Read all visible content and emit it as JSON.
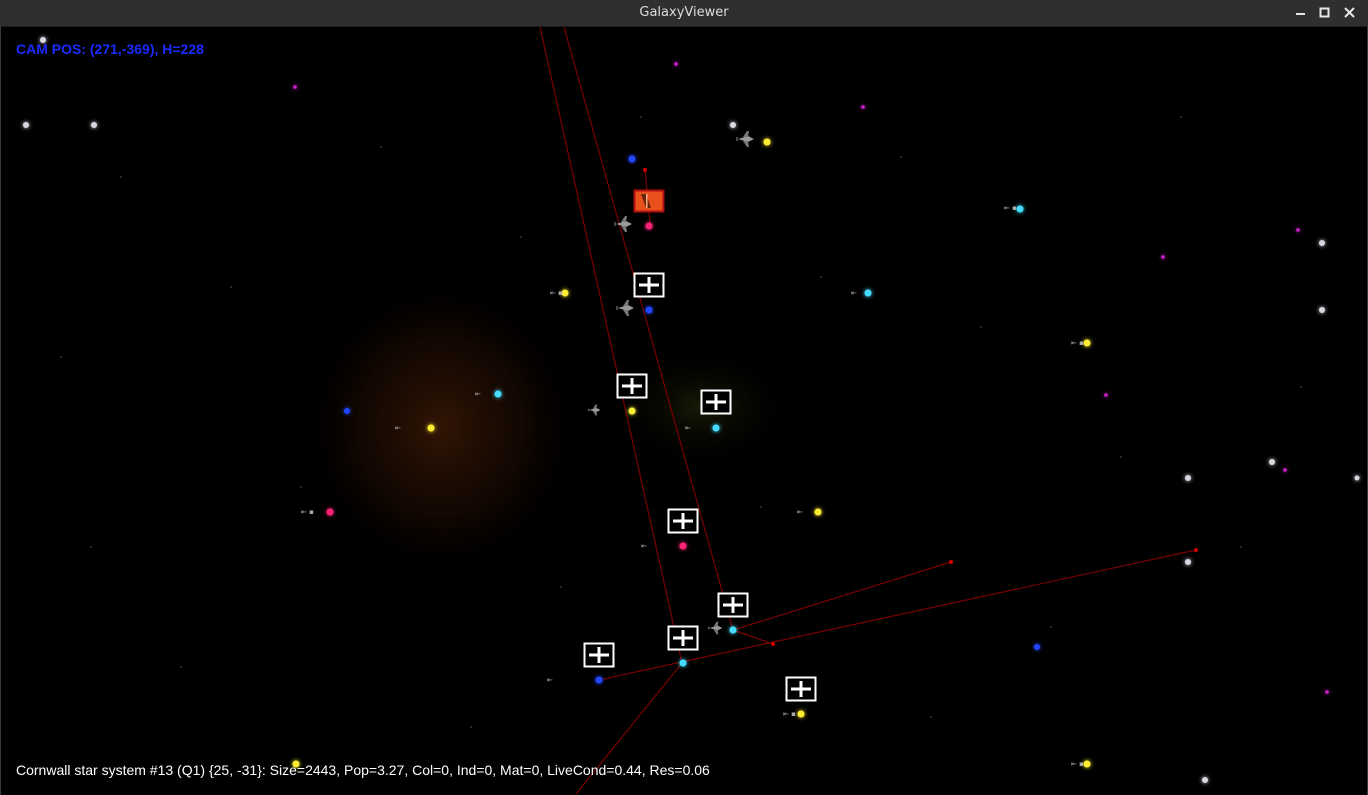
{
  "window": {
    "title": "GalaxyViewer",
    "controls": {
      "minimize": "minimize-icon",
      "maximize": "maximize-icon",
      "close": "close-icon"
    }
  },
  "hud": {
    "camera": "CAM POS: (271,-369), H=228",
    "status": "Cornwall star system #13 (Q1)  {25, -31}:  Size=2443, Pop=3.27, Col=0, Ind=0, Mat=0, LiveCond=0.44, Res=0.06"
  },
  "colors": {
    "hud_camera": "#1a2bff",
    "hud_status": "#ffffff",
    "route_line": "#8b0000",
    "selected_marker": "#e8501c",
    "star_yellow": "#ffee33",
    "star_cyan": "#44ddff",
    "star_white": "#dddddd",
    "star_blue": "#2244ff",
    "star_magenta": "#ff2277"
  },
  "icons": {
    "outpost_marker": "plus-box-icon",
    "selected_marker": "flag-icon",
    "ship": "fighter-ship-icon"
  }
}
